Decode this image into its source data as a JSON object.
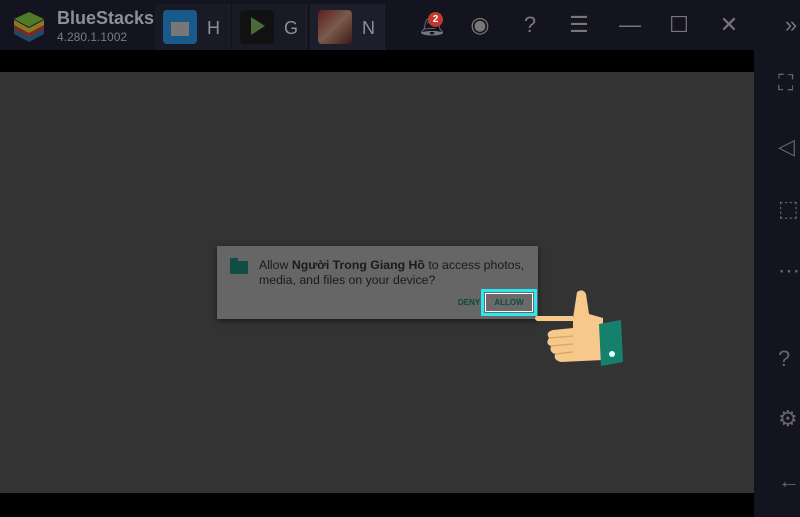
{
  "app": {
    "name": "BlueStacks",
    "version": "4.280.1.1002"
  },
  "tabs": [
    {
      "label": "H",
      "icon": "home-icon"
    },
    {
      "label": "G",
      "icon": "google-play-icon"
    },
    {
      "label": "N",
      "icon": "game-icon"
    }
  ],
  "toolbar": {
    "notification_count": "2",
    "icons": [
      "bell-icon",
      "account-icon",
      "help-icon",
      "menu-icon",
      "minimize-icon",
      "maximize-icon",
      "close-icon",
      "expand-sidebar-icon"
    ]
  },
  "sidebar": {
    "icons": [
      "fullscreen-icon",
      "volume-mute-icon",
      "screen-select-icon",
      "more-icon",
      "help-icon",
      "settings-icon",
      "back-icon"
    ]
  },
  "dialog": {
    "prefix": "Allow ",
    "app_name": "Người Trong Giang Hồ",
    "suffix": " to access photos, media, and files on your device?",
    "deny": "DENY",
    "allow": "ALLOW"
  },
  "colors": {
    "accent": "#2ee6ef",
    "button_text": "#0d4a40"
  }
}
